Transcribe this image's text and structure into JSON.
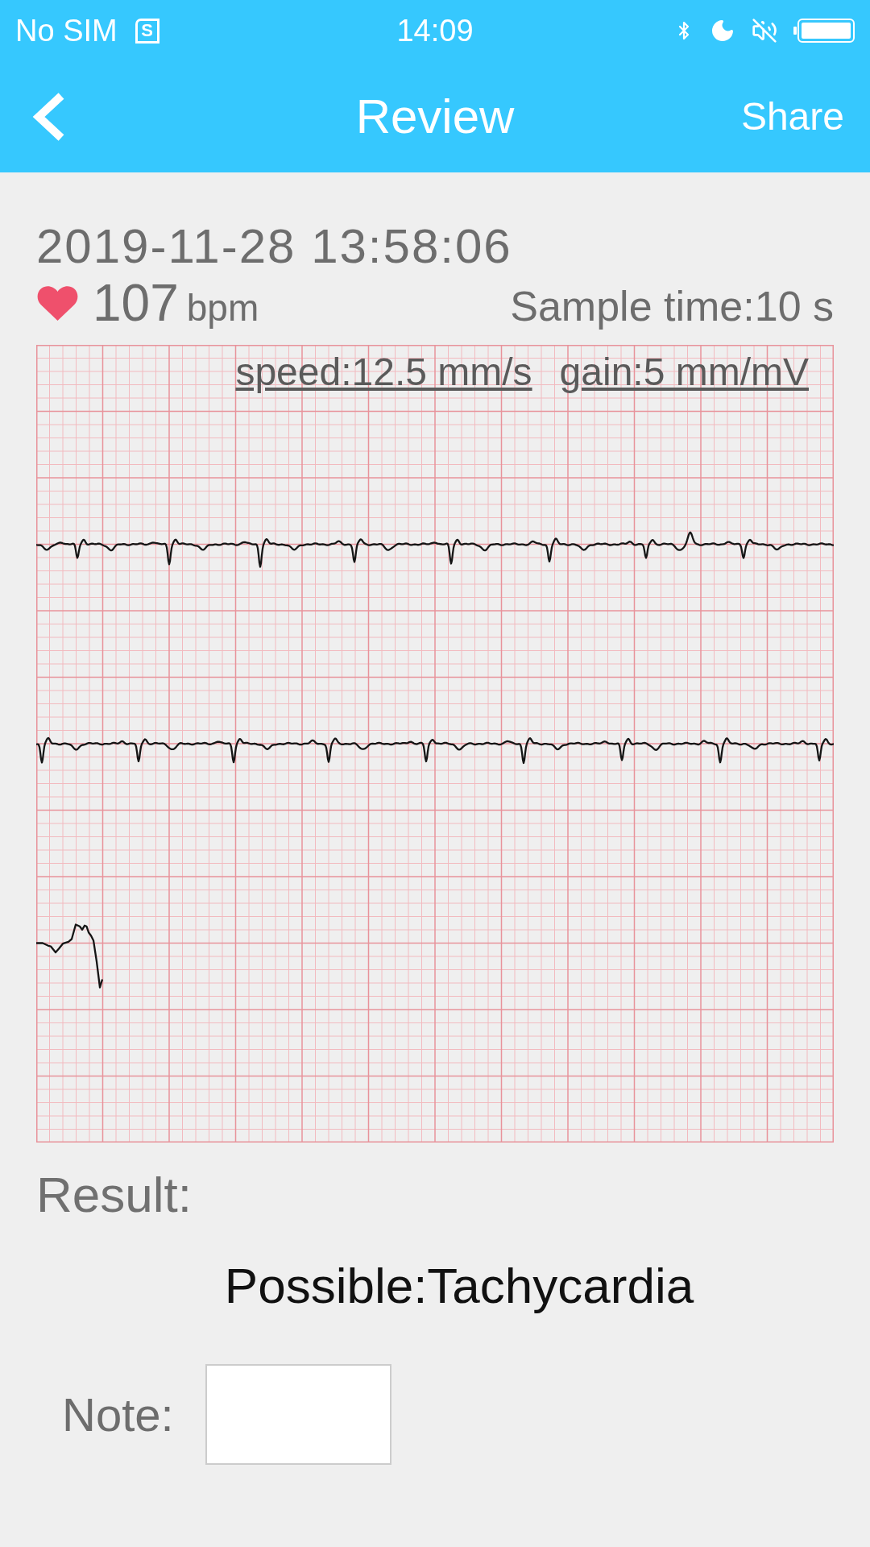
{
  "status_bar": {
    "carrier": "No SIM",
    "sim_icon_letter": "S",
    "time": "14:09"
  },
  "nav_bar": {
    "title": "Review",
    "action": "Share"
  },
  "record": {
    "timestamp": "2019-11-28 13:58:06",
    "heart_rate": "107",
    "heart_rate_unit": "bpm",
    "sample_time": "Sample time:10 s"
  },
  "ecg": {
    "speed": "speed:12.5 mm/s",
    "gain": "gain:5 mm/mV"
  },
  "result": {
    "label": "Result:",
    "text": "Possible:Tachycardia"
  },
  "note": {
    "label": "Note:"
  }
}
